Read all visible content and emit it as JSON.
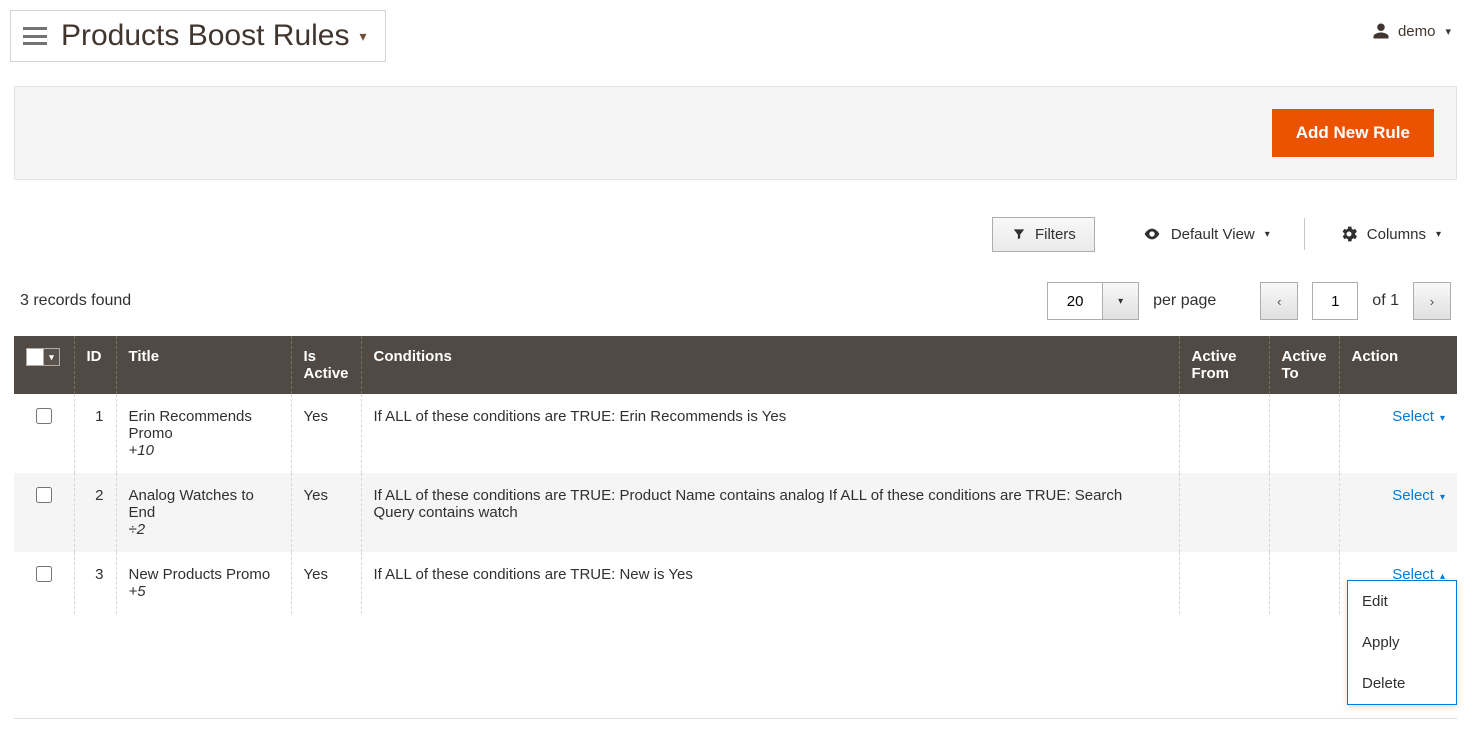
{
  "header": {
    "title": "Products Boost Rules",
    "user": "demo"
  },
  "actionBar": {
    "addNewRule": "Add New Rule"
  },
  "toolbar": {
    "filters": "Filters",
    "defaultView": "Default View",
    "columns": "Columns"
  },
  "records": {
    "foundText": "3 records found",
    "pageSize": "20",
    "perPageLabel": "per page",
    "currentPage": "1",
    "ofLabel": "of",
    "totalPages": "1"
  },
  "table": {
    "headers": {
      "id": "ID",
      "title": "Title",
      "isActive": "Is Active",
      "conditions": "Conditions",
      "activeFrom": "Active From",
      "activeTo": "Active To",
      "action": "Action"
    },
    "rows": [
      {
        "id": "1",
        "title": "Erin Recommends Promo",
        "modifier": "+10",
        "isActive": "Yes",
        "conditions": "If ALL of these conditions are TRUE: Erin Recommends is Yes",
        "activeFrom": "",
        "activeTo": "",
        "selectLabel": "Select",
        "menuOpen": false
      },
      {
        "id": "2",
        "title": "Analog Watches to End",
        "modifier": "÷2",
        "isActive": "Yes",
        "conditions": "If ALL of these conditions are TRUE: Product Name contains analog If ALL of these conditions are TRUE: Search Query contains watch",
        "activeFrom": "",
        "activeTo": "",
        "selectLabel": "Select",
        "menuOpen": false
      },
      {
        "id": "3",
        "title": "New Products Promo",
        "modifier": "+5",
        "isActive": "Yes",
        "conditions": "If ALL of these conditions are TRUE: New is Yes",
        "activeFrom": "",
        "activeTo": "",
        "selectLabel": "Select",
        "menuOpen": true
      }
    ],
    "actionMenu": {
      "edit": "Edit",
      "apply": "Apply",
      "delete": "Delete"
    }
  }
}
